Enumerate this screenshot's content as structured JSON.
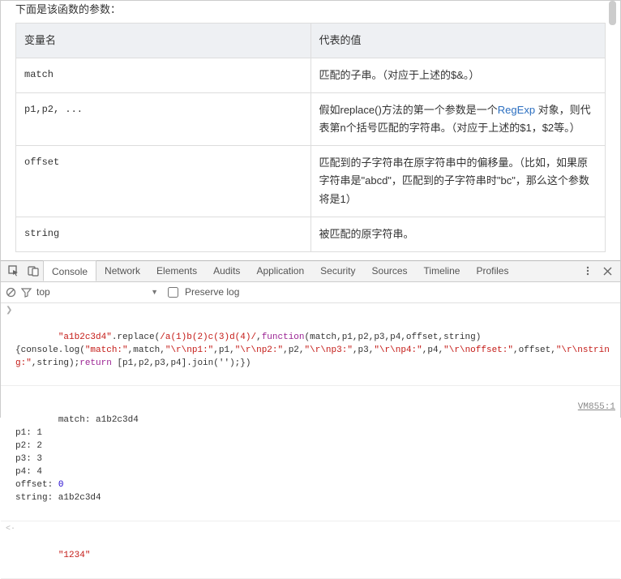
{
  "doc": {
    "intro": "下面是该函数的参数：",
    "headers": {
      "var": "变量名",
      "val": "代表的值"
    },
    "rows": [
      {
        "var": "match",
        "val_pre": "匹配的子串。（对应于上述的$&。）",
        "link": "",
        "val_post": ""
      },
      {
        "var": "p1,p2, ...",
        "val_pre": "假如replace()方法的第一个参数是一个",
        "link": "RegExp",
        "val_post": " 对象，则代表第n个括号匹配的字符串。（对应于上述的$1，$2等。）"
      },
      {
        "var": "offset",
        "val_pre": "匹配到的子字符串在原字符串中的偏移量。（比如，如果原字符串是\"abcd\"，匹配到的子字符串时\"bc\"，那么这个参数将是1）",
        "link": "",
        "val_post": ""
      },
      {
        "var": "string",
        "val_pre": "被匹配的原字符串。",
        "link": "",
        "val_post": ""
      }
    ]
  },
  "devtools": {
    "tabs": [
      "Console",
      "Network",
      "Elements",
      "Audits",
      "Application",
      "Security",
      "Sources",
      "Timeline",
      "Profiles"
    ],
    "active_tab": 0,
    "toolbar": {
      "context": "top",
      "preserve_log": "Preserve log"
    },
    "source_link": "VM855:1",
    "input_call": {
      "pre_str": "\"a1b2c3d4\"",
      "method": ".replace(",
      "regex": "/a(1)b(2)c(3)d(4)/",
      "comma": ",",
      "fn_kw": "function",
      "fn_sig": "(match,p1,p2,p3,p4,offset,string)",
      "body_open": "{console.log(",
      "args": [
        "\"match:\"",
        ",match,",
        "\"\\r\\np1:\"",
        ",p1,",
        "\"\\r\\np2:\"",
        ",p2,",
        "\"\\r\\np3:\"",
        ",p3,",
        "\"\\r\\np4:\"",
        ",p4,",
        "\"\\r\\noffset:\"",
        ",offset,",
        "\"\\r\\nstring:\"",
        ",string);"
      ],
      "return_kw": "return",
      "return_tail": " [p1,p2,p3,p4].join('');})"
    },
    "log_output": [
      "match: a1b2c3d4",
      "p1: 1",
      "p2: 2",
      "p3: 3",
      "p4: 4"
    ],
    "offset_label": "offset: ",
    "offset_value": "0",
    "string_line": "string: a1b2c3d4",
    "result": "\"1234\""
  }
}
